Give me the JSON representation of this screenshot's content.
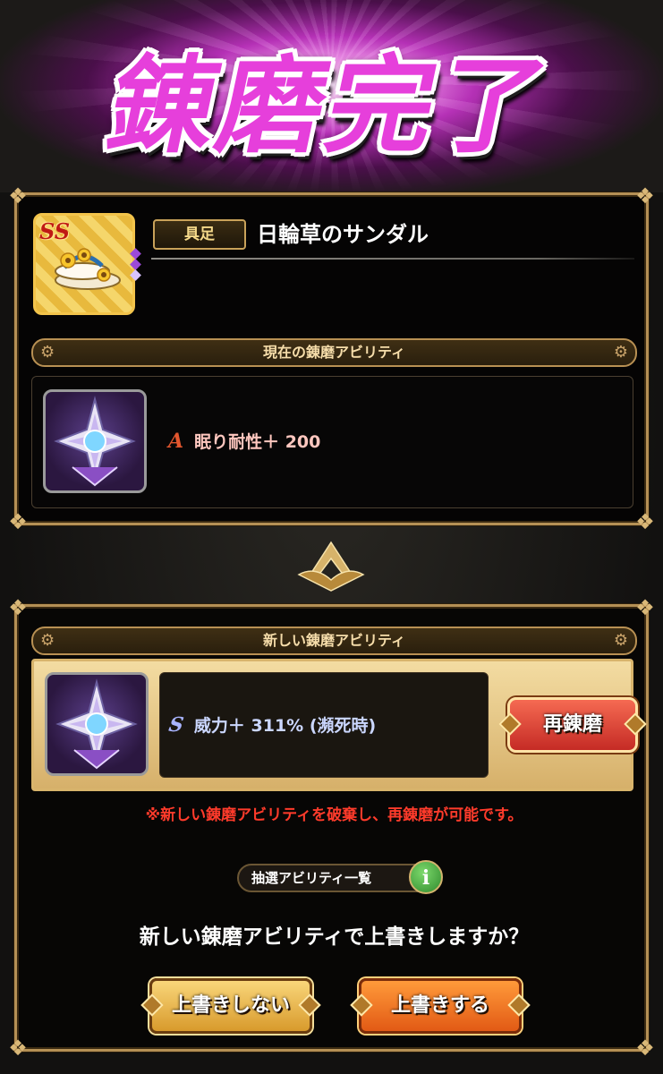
{
  "header": {
    "title": "錬磨完了"
  },
  "item": {
    "rank_badge": "SS",
    "type_tag": "具足",
    "name": "日輪草のサンダル"
  },
  "current": {
    "section_title": "現在の錬磨アビリティ",
    "rank": "A",
    "ability": "眠り耐性＋ 200"
  },
  "new": {
    "section_title": "新しい錬磨アビリティ",
    "rank": "S",
    "ability": "威力＋ 311% (瀕死時)",
    "reroll_button": "再錬磨",
    "notice": "※新しい錬磨アビリティを破棄し、再錬磨が可能です。",
    "list_button": "抽選アビリティ一覧",
    "info_icon": "i",
    "question": "新しい錬磨アビリティで上書きしますか？",
    "no_button": "上書きしない",
    "yes_button": "上書きする"
  },
  "colors": {
    "title_magenta": "#e63fdb",
    "gold_border": "#b59055",
    "notice_red": "#ff3b2b",
    "reroll_red": "#c52b25",
    "confirm_orange": "#e25a15"
  },
  "icons": [
    "sandal-icon",
    "medal-icon",
    "gear-icon",
    "info-icon",
    "divider-emblem-icon"
  ]
}
